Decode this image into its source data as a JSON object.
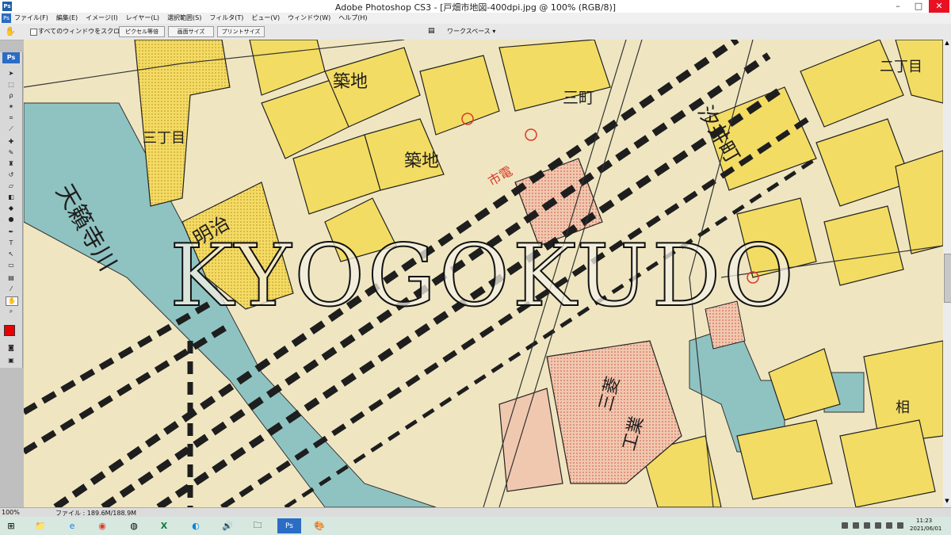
{
  "window": {
    "title": "Adobe Photoshop CS3 - [戸畑市地図-400dpi.jpg @ 100% (RGB/8)]"
  },
  "menu": {
    "items": [
      "ファイル(F)",
      "編集(E)",
      "イメージ(I)",
      "レイヤー(L)",
      "選択範囲(S)",
      "フィルタ(T)",
      "ビュー(V)",
      "ウィンドウ(W)",
      "ヘルプ(H)"
    ]
  },
  "options": {
    "scroll_all_label": "すべてのウィンドウをスクロール",
    "actual_pixels": "ピクセル等倍",
    "fit_screen": "画面サイズ",
    "print_size": "プリントサイズ",
    "workspace": "ワークスペース ▾"
  },
  "map": {
    "watermark": "KYOGOKUDO",
    "labels": {
      "tsukiji": "築地",
      "sancho": "三丁目",
      "tenraiji": "天籟寺川",
      "meijisho": "明治",
      "shiei": "市電",
      "kitahara": "汐井町",
      "sanmachi": "三町",
      "nicho": "二丁目",
      "sonocho": "相",
      "mitsubishi": "三菱",
      "kouki": "工業"
    }
  },
  "status": {
    "zoom": "100%",
    "file": "ファイル : 189.6M/188.9M"
  },
  "clock": {
    "time": "11:23",
    "date": "2021/06/01"
  },
  "colors": {
    "water": "#8fc3c2",
    "block": "#f3dc63",
    "paper": "#efe6c1",
    "pink": "#f0c8b0",
    "ink": "#1e1e1e",
    "red": "#d93a2b"
  }
}
